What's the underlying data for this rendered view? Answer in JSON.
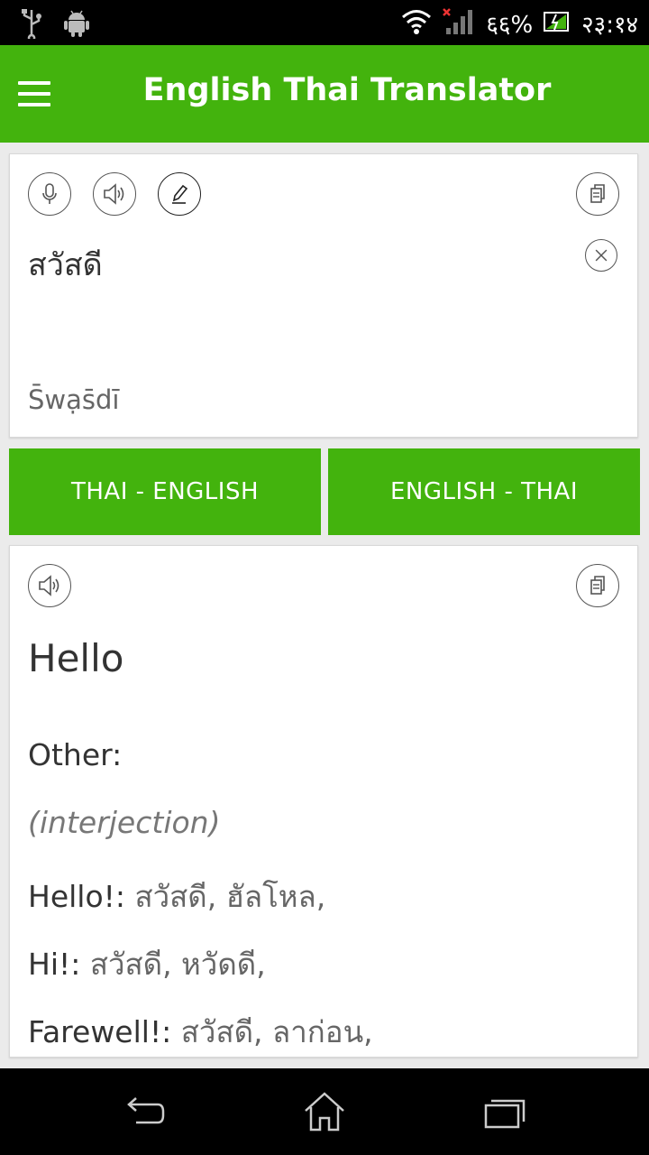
{
  "status_bar": {
    "battery": "६६%",
    "time": "२३:१४"
  },
  "app_bar": {
    "title": "English Thai Translator"
  },
  "input_card": {
    "text": "สวัสดี",
    "transliteration": "S̄wạs̄dī"
  },
  "language_buttons": {
    "thai_english": "THAI - ENGLISH",
    "english_thai": "ENGLISH - THAI"
  },
  "result_card": {
    "main": "Hello",
    "other_label": "Other:",
    "part_of_speech": "(interjection)",
    "entries": [
      {
        "word": "Hello!:",
        "thai": " สวัสดี, ฮัลโหล,"
      },
      {
        "word": "Hi!:",
        "thai": " สวัสดี, หวัดดี,"
      },
      {
        "word": "Farewell!:",
        "thai": " สวัสดี, ลาก่อน,"
      }
    ]
  },
  "colors": {
    "accent": "#43b30d",
    "status_bar": "#000000",
    "background": "#ebebeb"
  }
}
